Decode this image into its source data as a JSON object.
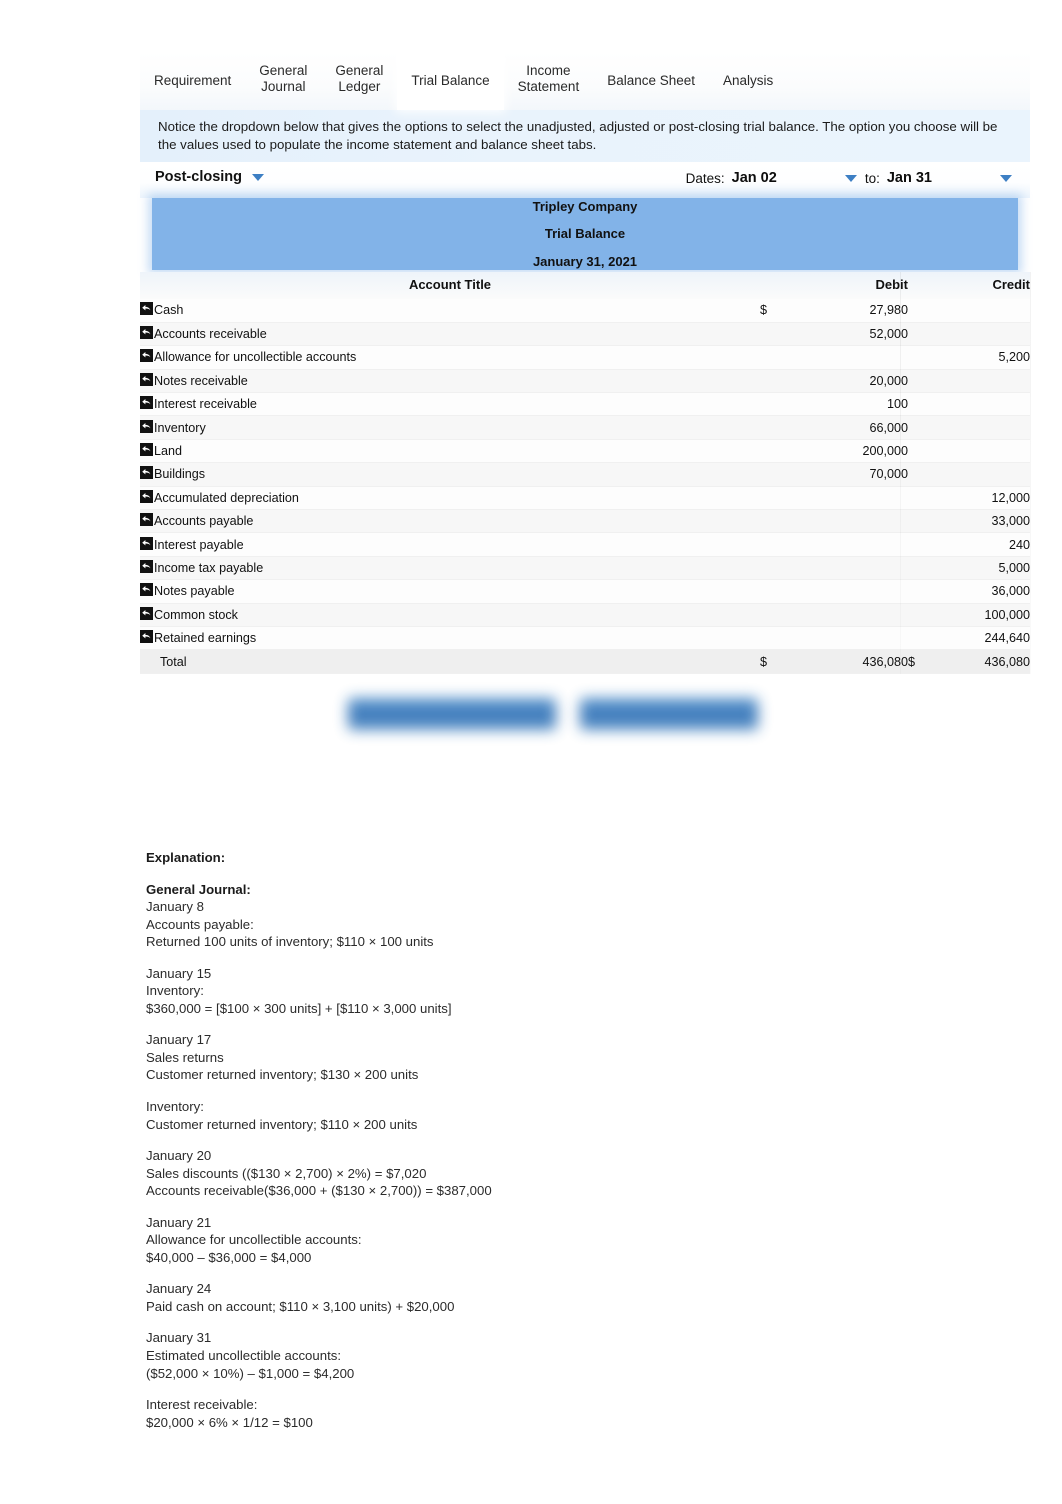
{
  "tabs": [
    {
      "label": "Requirement",
      "active": false
    },
    {
      "label": "General\nJournal",
      "active": false
    },
    {
      "label": "General\nLedger",
      "active": false
    },
    {
      "label": "Trial Balance",
      "active": true
    },
    {
      "label": "Income\nStatement",
      "active": false
    },
    {
      "label": "Balance Sheet",
      "active": false
    },
    {
      "label": "Analysis",
      "active": false
    }
  ],
  "info_banner": {
    "text": "Notice the dropdown below that gives the options to select the unadjusted, adjusted or post-closing trial balance. The option you choose will be the values used to populate the income statement and balance sheet tabs."
  },
  "controls": {
    "balance_type": "Post-closing",
    "dates_label": "Dates:",
    "date_from": "Jan 02",
    "to_label": "to:",
    "date_to": "Jan 31"
  },
  "report_header": {
    "company": "Tripley Company",
    "statement": "Trial Balance",
    "date": "January 31, 2021",
    "banner_color": "#82b3e8"
  },
  "table": {
    "columns": [
      "Account Title",
      "Debit",
      "Credit"
    ],
    "rows": [
      {
        "account": "Cash",
        "debit_symbol": "$",
        "debit": "27,980",
        "credit_symbol": "",
        "credit": ""
      },
      {
        "account": "Accounts receivable",
        "debit_symbol": "",
        "debit": "52,000",
        "credit_symbol": "",
        "credit": ""
      },
      {
        "account": "Allowance for uncollectible accounts",
        "debit_symbol": "",
        "debit": "",
        "credit_symbol": "",
        "credit": "5,200"
      },
      {
        "account": "Notes receivable",
        "debit_symbol": "",
        "debit": "20,000",
        "credit_symbol": "",
        "credit": ""
      },
      {
        "account": "Interest receivable",
        "debit_symbol": "",
        "debit": "100",
        "credit_symbol": "",
        "credit": ""
      },
      {
        "account": "Inventory",
        "debit_symbol": "",
        "debit": "66,000",
        "credit_symbol": "",
        "credit": ""
      },
      {
        "account": "Land",
        "debit_symbol": "",
        "debit": "200,000",
        "credit_symbol": "",
        "credit": ""
      },
      {
        "account": "Buildings",
        "debit_symbol": "",
        "debit": "70,000",
        "credit_symbol": "",
        "credit": ""
      },
      {
        "account": "Accumulated depreciation",
        "debit_symbol": "",
        "debit": "",
        "credit_symbol": "",
        "credit": "12,000"
      },
      {
        "account": "Accounts payable",
        "debit_symbol": "",
        "debit": "",
        "credit_symbol": "",
        "credit": "33,000"
      },
      {
        "account": "Interest payable",
        "debit_symbol": "",
        "debit": "",
        "credit_symbol": "",
        "credit": "240"
      },
      {
        "account": "Income tax payable",
        "debit_symbol": "",
        "debit": "",
        "credit_symbol": "",
        "credit": "5,000"
      },
      {
        "account": "Notes payable",
        "debit_symbol": "",
        "debit": "",
        "credit_symbol": "",
        "credit": "36,000"
      },
      {
        "account": "Common stock",
        "debit_symbol": "",
        "debit": "",
        "credit_symbol": "",
        "credit": "100,000"
      },
      {
        "account": "Retained earnings",
        "debit_symbol": "",
        "debit": "",
        "credit_symbol": "",
        "credit": "244,640"
      }
    ],
    "total": {
      "account": "Total",
      "debit_symbol": "$",
      "debit": "436,080",
      "credit_symbol": "$",
      "credit": "436,080"
    },
    "row_icon": "back-arrow-icon"
  },
  "action_buttons": [
    {
      "label": "",
      "blurred": true
    },
    {
      "label": "",
      "blurred": true
    }
  ],
  "explanation": {
    "heading": "Explanation:",
    "sections": [
      {
        "title": "General Journal:",
        "lines": [
          "January 8",
          "Accounts payable:",
          "Returned 100 units of inventory; $110 × 100 units"
        ]
      },
      {
        "title": "",
        "lines": [
          "January 15",
          "Inventory:",
          "$360,000 = [$100 × 300 units] + [$110 × 3,000 units]"
        ]
      },
      {
        "title": "",
        "lines": [
          "January 17",
          "Sales returns",
          "Customer returned inventory; $130 × 200 units"
        ]
      },
      {
        "title": "",
        "lines": [
          "Inventory:",
          "Customer returned inventory; $110 × 200 units"
        ]
      },
      {
        "title": "",
        "lines": [
          "January 20",
          "Sales discounts (($130 × 2,700) × 2%) = $7,020",
          "Accounts receivable($36,000 + ($130 × 2,700)) = $387,000"
        ]
      },
      {
        "title": "",
        "lines": [
          "January 21",
          "Allowance for uncollectible accounts:",
          "$40,000 – $36,000 = $4,000"
        ]
      },
      {
        "title": "",
        "lines": [
          "January 24",
          "Paid cash on account; $110 × 3,100 units) + $20,000"
        ]
      },
      {
        "title": "",
        "lines": [
          "January 31",
          "Estimated uncollectible accounts:",
          "($52,000 × 10%) – $1,000 = $4,200"
        ]
      },
      {
        "title": "",
        "lines": [
          "Interest receivable:",
          "$20,000 × 6% × 1/12 = $100"
        ]
      }
    ]
  }
}
